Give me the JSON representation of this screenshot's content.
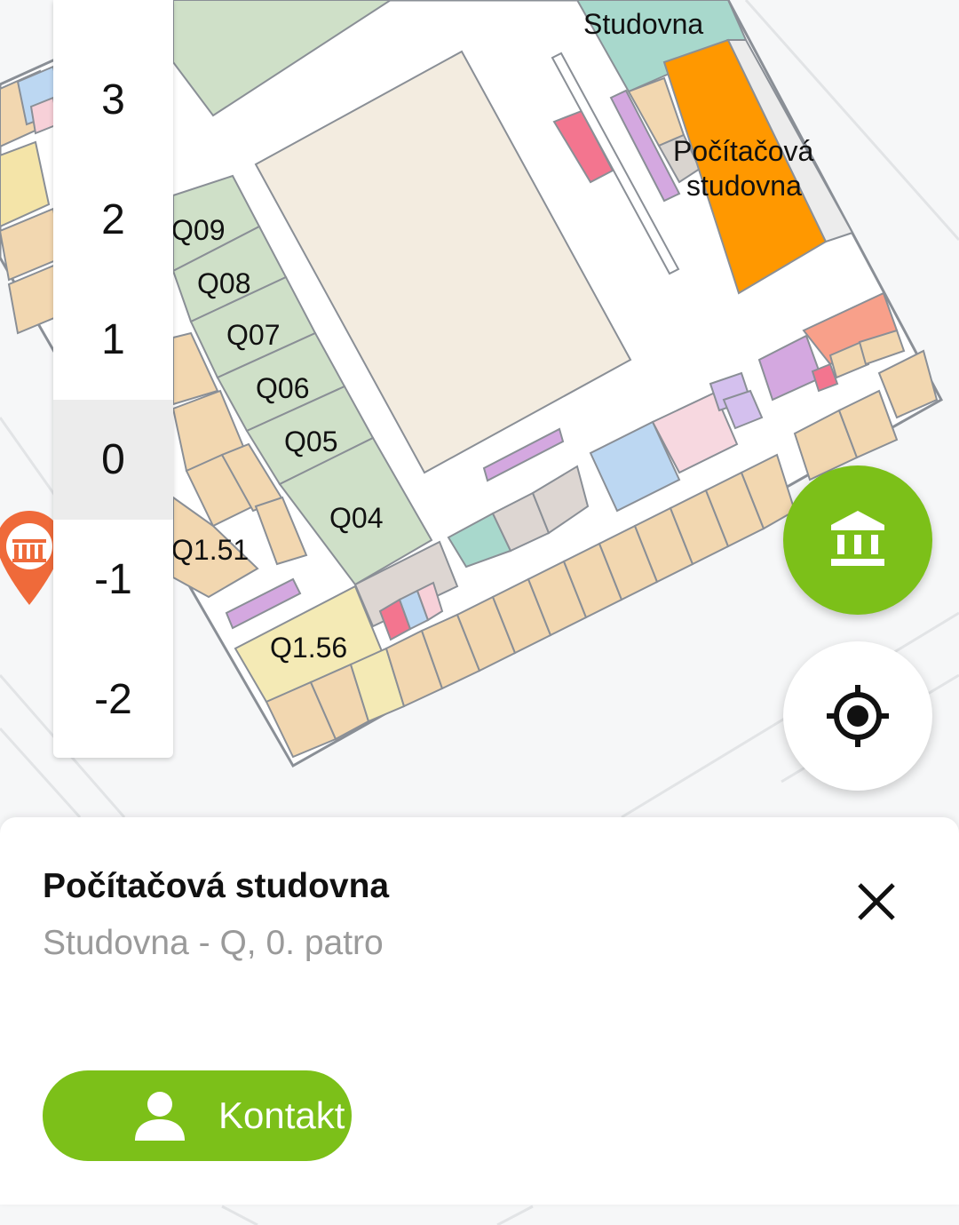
{
  "map": {
    "room_labels": {
      "studovna": "Studovna",
      "pocitacova_line1": "Počítačová",
      "pocitacova_line2": "studovna",
      "q09": "Q09",
      "q08": "Q08",
      "q07": "Q07",
      "q06": "Q06",
      "q05": "Q05",
      "q04": "Q04",
      "q151": "Q1.51",
      "q156": "Q1.56"
    },
    "colors": {
      "selected_room": "#ff9800",
      "study_room": "#a8d8cc",
      "classroom": "#cfe0c8",
      "hall": "#f3ece0",
      "office": "#f2d7b0",
      "accent_green": "#7cc019",
      "pin": "#ef6a3a"
    }
  },
  "floor_selector": {
    "floors": [
      "3",
      "2",
      "1",
      "0",
      "-1",
      "-2"
    ],
    "selected": "0"
  },
  "fab": {
    "buildings_icon": "building-icon",
    "location_icon": "my-location-icon"
  },
  "detail": {
    "title": "Počítačová studovna",
    "subtitle": "Studovna - Q, 0. patro",
    "close_icon": "close-icon",
    "contact_label": "Kontakt",
    "contact_icon": "person-icon"
  }
}
